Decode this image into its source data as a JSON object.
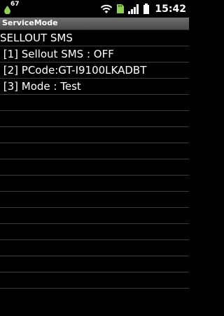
{
  "status_bar": {
    "notification_count": "67",
    "time": "15:42",
    "icons": [
      "notification-drop-icon",
      "wifi-icon",
      "sd-card-icon",
      "signal-icon",
      "battery-icon"
    ]
  },
  "title_bar": {
    "title": "ServiceMode"
  },
  "rows": [
    "SELLOUT SMS",
    " [1] Sellout SMS : OFF",
    " [2] PCode:GT-I9100LKADBT",
    " [3] Mode : Test",
    "",
    "",
    "",
    "",
    "",
    "",
    "",
    "",
    "",
    "",
    "",
    ""
  ]
}
